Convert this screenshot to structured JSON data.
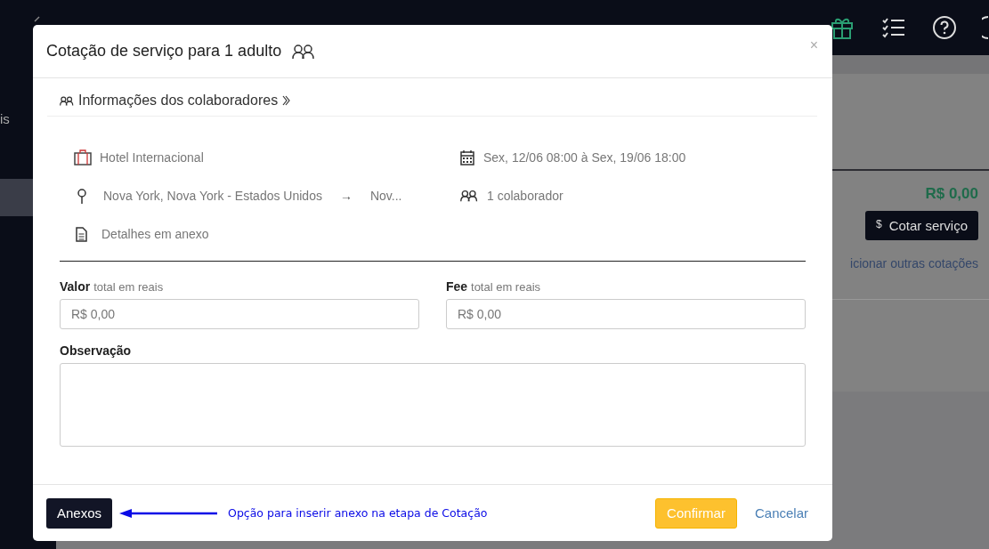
{
  "sidebar": {
    "items": [
      {
        "label": "is",
        "selected": false
      },
      {
        "selected": true
      }
    ]
  },
  "card": {
    "price": "R$ 0,00",
    "quote_icon": "$",
    "quote_button": "Cotar serviço",
    "link": "icionar outras cotações"
  },
  "modal": {
    "title": "Cotação de serviço para 1 adulto",
    "close": "×",
    "section": "Informações dos colaboradores",
    "details": [
      {
        "kind": "hotel",
        "text": "Hotel Internacional"
      },
      {
        "kind": "date",
        "text": "Sex, 12/06 08:00 à Sex, 19/06 18:00"
      },
      {
        "kind": "route",
        "from": "Nova York, Nova York - Estados Unidos",
        "arrow": "→",
        "to": "Nov..."
      },
      {
        "kind": "people",
        "text": "1 colaborador"
      },
      {
        "kind": "document",
        "text": "Detalhes em anexo"
      }
    ],
    "fields": [
      {
        "label": "Valor",
        "hint": "total em reais",
        "placeholder": "R$ 0,00"
      },
      {
        "label": "Fee",
        "hint": "total em reais",
        "placeholder": "R$ 0,00"
      }
    ],
    "observation": {
      "label": "Observação"
    },
    "attach_button": "Anexos",
    "annotation": "Opção para inserir anexo na etapa de Cotação",
    "confirm_button": "Confirmar",
    "cancel_button": "Cancelar"
  }
}
